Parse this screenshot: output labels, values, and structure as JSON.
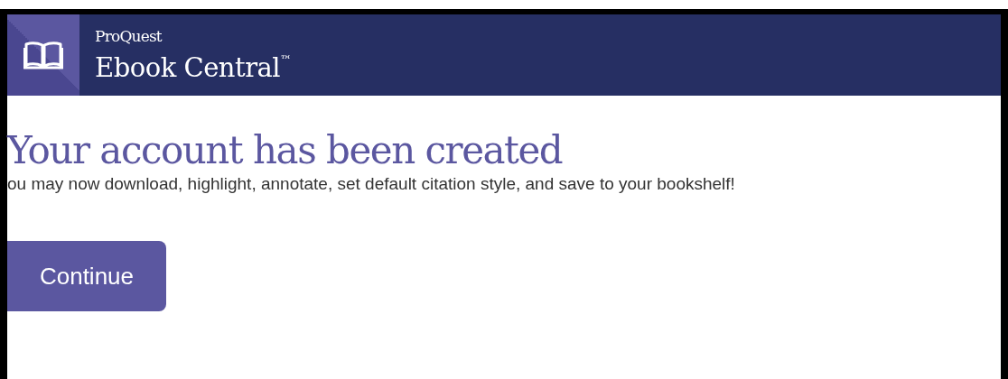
{
  "header": {
    "brand_small": "ProQuest",
    "brand_large": "Ebook Central",
    "trademark": "™"
  },
  "message": {
    "title": "Your account has been created",
    "text": "ou may now download, highlight, annotate, set default citation style, and save to your bookshelf!"
  },
  "buttons": [
    {
      "label": "Continue"
    }
  ]
}
